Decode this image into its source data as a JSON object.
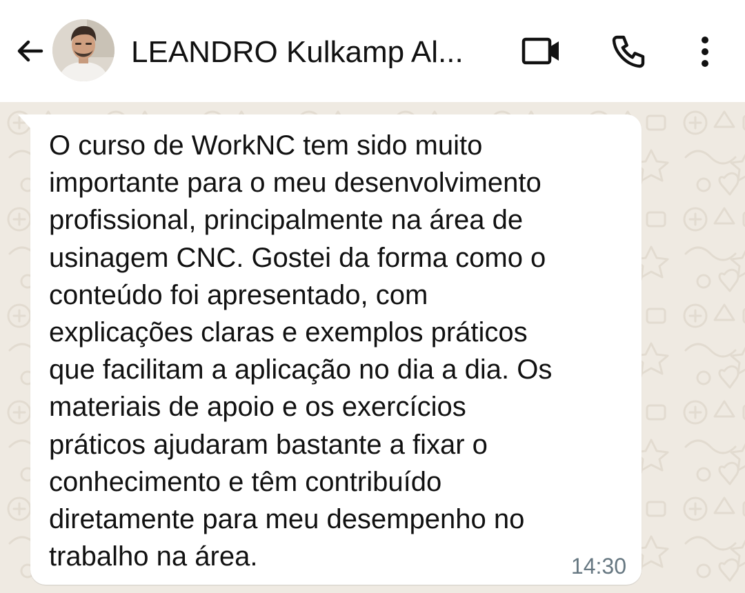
{
  "header": {
    "contact_name": "LEANDRO Kulkamp Al...",
    "back_icon": "arrow-back-icon",
    "video_icon": "video-call-icon",
    "phone_icon": "phone-call-icon",
    "menu_icon": "more-vertical-icon"
  },
  "message": {
    "text": "O curso de WorkNC tem sido muito\nimportante para o meu desenvolvimento\nprofissional, principalmente na área de\nusinagem CNC. Gostei da forma como o\nconteúdo foi apresentado, com\nexplicações claras e exemplos práticos\nque facilitam a aplicação no dia a dia. Os\nmateriais de apoio e os exercícios\npráticos ajudaram bastante a fixar o\nconhecimento e têm contribuído\ndiretamente para meu desempenho no\ntrabalho na área.",
    "time": "14:30"
  },
  "colors": {
    "chat_background": "#efeae2",
    "bubble": "#ffffff",
    "text": "#111111",
    "timestamp": "#667781"
  }
}
